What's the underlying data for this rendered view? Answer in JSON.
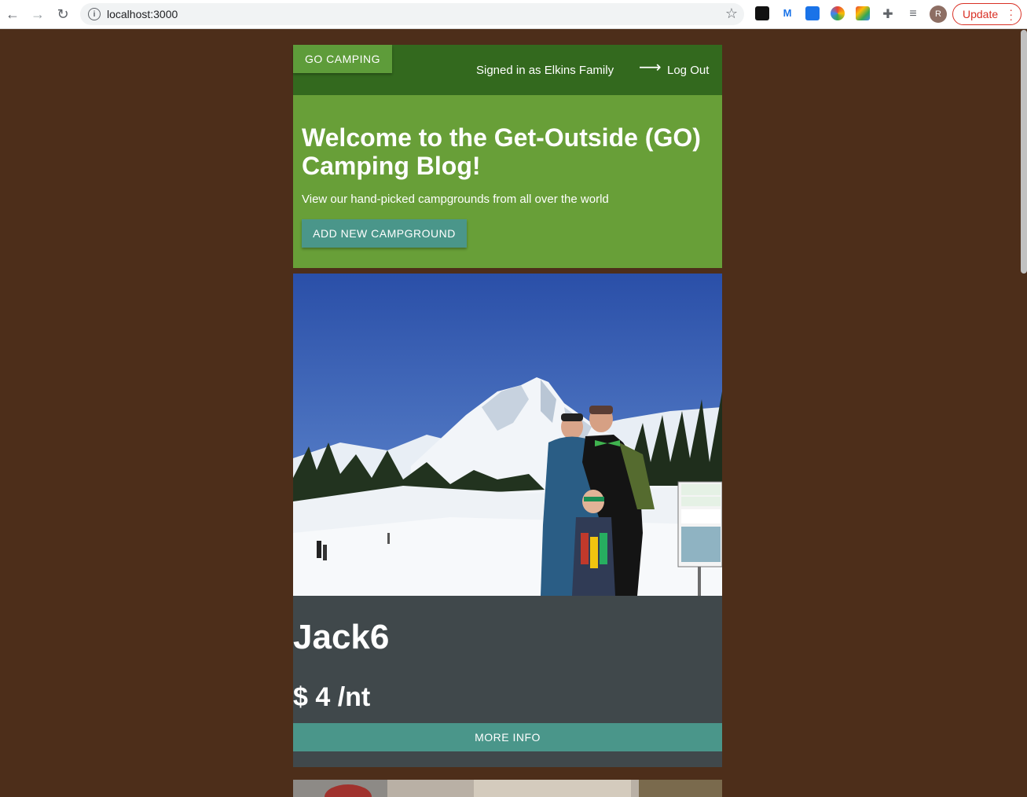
{
  "browser": {
    "url": "localhost:3000",
    "profile_initial": "R",
    "update_label": "Update"
  },
  "nav": {
    "brand": "GO CAMPING",
    "signed_in_text": "Signed in as Elkins Family",
    "arrow": "⟶",
    "logout": "Log Out"
  },
  "hero": {
    "title": "Welcome to the Get-Outside (GO) Camping Blog!",
    "subtitle": "View our hand-picked campgrounds from all over the world",
    "add_button": "ADD NEW CAMPGROUND"
  },
  "campgrounds": [
    {
      "name": "Jack6",
      "price": "$ 4 /nt",
      "button": "MORE INFO"
    }
  ],
  "colors": {
    "page_bg": "#4d2e1a",
    "navbar": "#33691e",
    "hero": "#689f38",
    "teal_button": "#4a968a",
    "card": "#40484b"
  }
}
